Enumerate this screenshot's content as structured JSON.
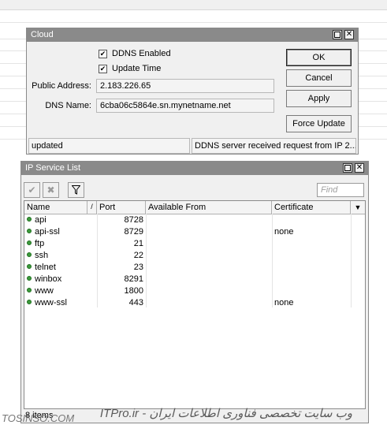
{
  "cloud": {
    "title": "Cloud",
    "ddns_enabled": {
      "label": "DDNS Enabled",
      "checked": true
    },
    "update_time": {
      "label": "Update Time",
      "checked": true
    },
    "public_address": {
      "label": "Public Address:",
      "value": "2.183.226.65"
    },
    "dns_name": {
      "label": "DNS Name:",
      "value": "6cba06c5864e.sn.mynetname.net"
    },
    "buttons": {
      "ok": "OK",
      "cancel": "Cancel",
      "apply": "Apply",
      "force_update": "Force Update"
    },
    "status_left": "updated",
    "status_right": "DDNS server received request from IP 2...."
  },
  "service_list": {
    "title": "IP Service List",
    "find_placeholder": "Find",
    "columns": {
      "name": "Name",
      "port": "Port",
      "available_from": "Available From",
      "certificate": "Certificate"
    },
    "rows": [
      {
        "name": "api",
        "port": "8728",
        "available_from": "",
        "certificate": ""
      },
      {
        "name": "api-ssl",
        "port": "8729",
        "available_from": "",
        "certificate": "none"
      },
      {
        "name": "ftp",
        "port": "21",
        "available_from": "",
        "certificate": ""
      },
      {
        "name": "ssh",
        "port": "22",
        "available_from": "",
        "certificate": ""
      },
      {
        "name": "telnet",
        "port": "23",
        "available_from": "",
        "certificate": ""
      },
      {
        "name": "winbox",
        "port": "8291",
        "available_from": "",
        "certificate": ""
      },
      {
        "name": "www",
        "port": "1800",
        "available_from": "",
        "certificate": ""
      },
      {
        "name": "www-ssl",
        "port": "443",
        "available_from": "",
        "certificate": "none"
      }
    ],
    "item_count": "8 items"
  },
  "watermark": {
    "left": "TOSINSO.COM",
    "right": "ITPro.ir - وب سایت تخصصی فناوری اطلاعات ایران"
  },
  "colors": {
    "titlebar": "#8a8a8a",
    "status_dot": "#3c9a3c"
  }
}
